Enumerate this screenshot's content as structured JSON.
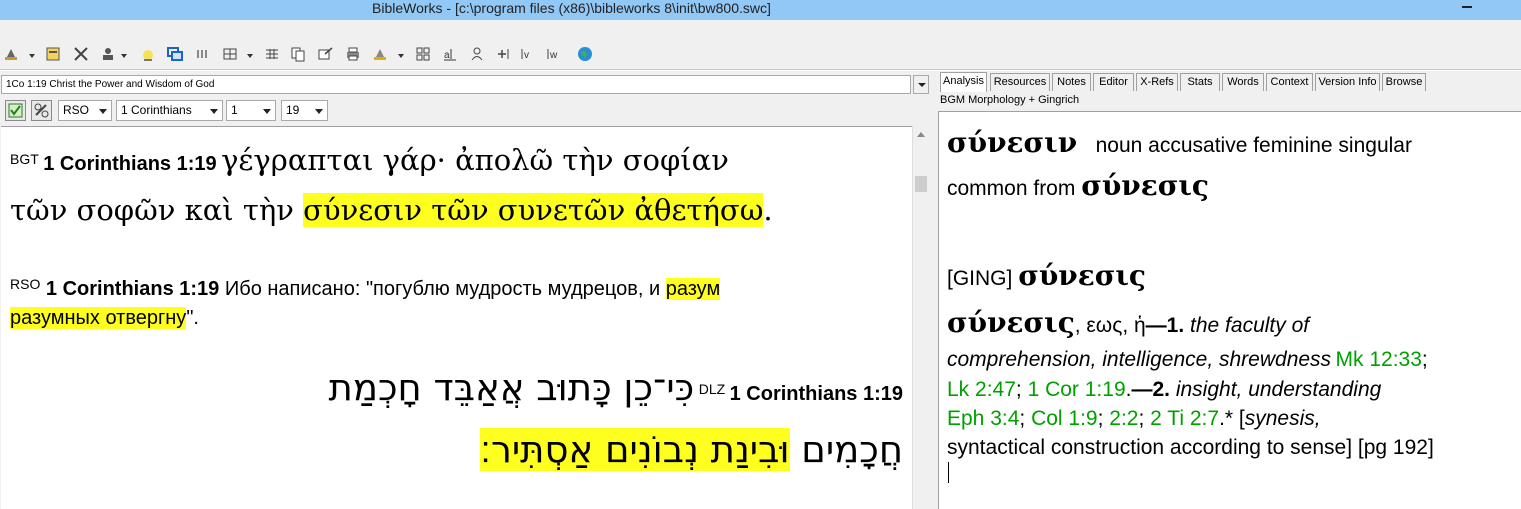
{
  "window": {
    "title": "BibleWorks - [c:\\program files (x86)\\bibleworks 8\\init\\bw800.swc]"
  },
  "toolbar": {
    "icons": [
      "search-icon",
      "database-icon",
      "tools-icon",
      "user-icon",
      "lamp-icon",
      "windows-icon",
      "tally-icon",
      "layout-icon",
      "parallel-icon",
      "copy-icon",
      "export-icon",
      "print-icon",
      "lexicon-icon",
      "grid-icon",
      "notes-icon",
      "person-icon",
      "plus-icon",
      "ev-icon",
      "ew-icon",
      "globe-icon"
    ]
  },
  "left": {
    "verse_context": "1Co 1:19 Christ the Power and Wisdom of God",
    "version_select": "RSO",
    "book_select": "1 Corinthians",
    "chapter_select": "1",
    "verse_select": "19",
    "verses": {
      "bgt": {
        "label": "BGT",
        "ref": "1 Corinthians 1:19",
        "line1": "γέγραπται γάρ· ἀπολῶ τὴν σοφίαν",
        "line2_plain": "τῶν σοφῶν καὶ τὴν ",
        "line2_hl": "σύνεσιν τῶν συνετῶν ἀθετήσω",
        "line2_end": "."
      },
      "rso": {
        "label": "RSO",
        "ref": "1 Corinthians 1:19",
        "line1_plain": "Ибо написано: \"погублю мудрость мудрецов, и ",
        "line1_hl": "разум",
        "line2_hl": "разумных отвергну",
        "line2_end": "\"."
      },
      "dlz": {
        "label": "DLZ",
        "ref": "1 Corinthians 1:19",
        "line1": "כִּי־כֵן כָּתוּב אֲאַבֵּד חָכְמַת",
        "line2_plain": "חֲכָמִים ",
        "line2_hl": "וּבִינַת נְבוֹנִים אַסְתִּיר׃"
      }
    }
  },
  "right": {
    "tabs": [
      "Analysis",
      "Resources",
      "Notes",
      "Editor",
      "X-Refs",
      "Stats",
      "Words",
      "Context",
      "Version Info",
      "Browse"
    ],
    "active_tab": "Analysis",
    "subtitle": "BGM Morphology + Gingrich",
    "analysis": {
      "word": "σύνεσιν",
      "parse": "noun accusative feminine singular",
      "common_from": "common from ",
      "lemma": "σύνεσις",
      "ging_label": "[GING] ",
      "ging_lemma": "σύνεσις",
      "entry_head": "σύνεσις",
      "entry_gen": ", εως, ἡ",
      "num1": "—1.",
      "def1a": " the faculty of",
      "def1b": "comprehension, intelligence, shrewdness",
      "ref_mk": "Mk 12:33",
      "semi1": ";",
      "ref_lk": "Lk 2:47",
      "semi2": "; ",
      "ref_cor": "1 Cor 1:19",
      "dot1": ".",
      "num2": "—2.",
      "def2": " insight, understanding",
      "ref_eph": "Eph 3:4",
      "semi3": "; ",
      "ref_col": "Col 1:9",
      "semi4": "; ",
      "ref_22": "2:2",
      "semi5": "; ",
      "ref_ti": "2 Ti 2:7",
      "tail1": ".* [",
      "synesis": "synesis,",
      "tail2": "syntactical construction according to sense] [pg 192]"
    }
  },
  "colors": {
    "titlebar": "#91c8f5",
    "highlight": "#ffff1f",
    "link_green": "#00a000"
  }
}
